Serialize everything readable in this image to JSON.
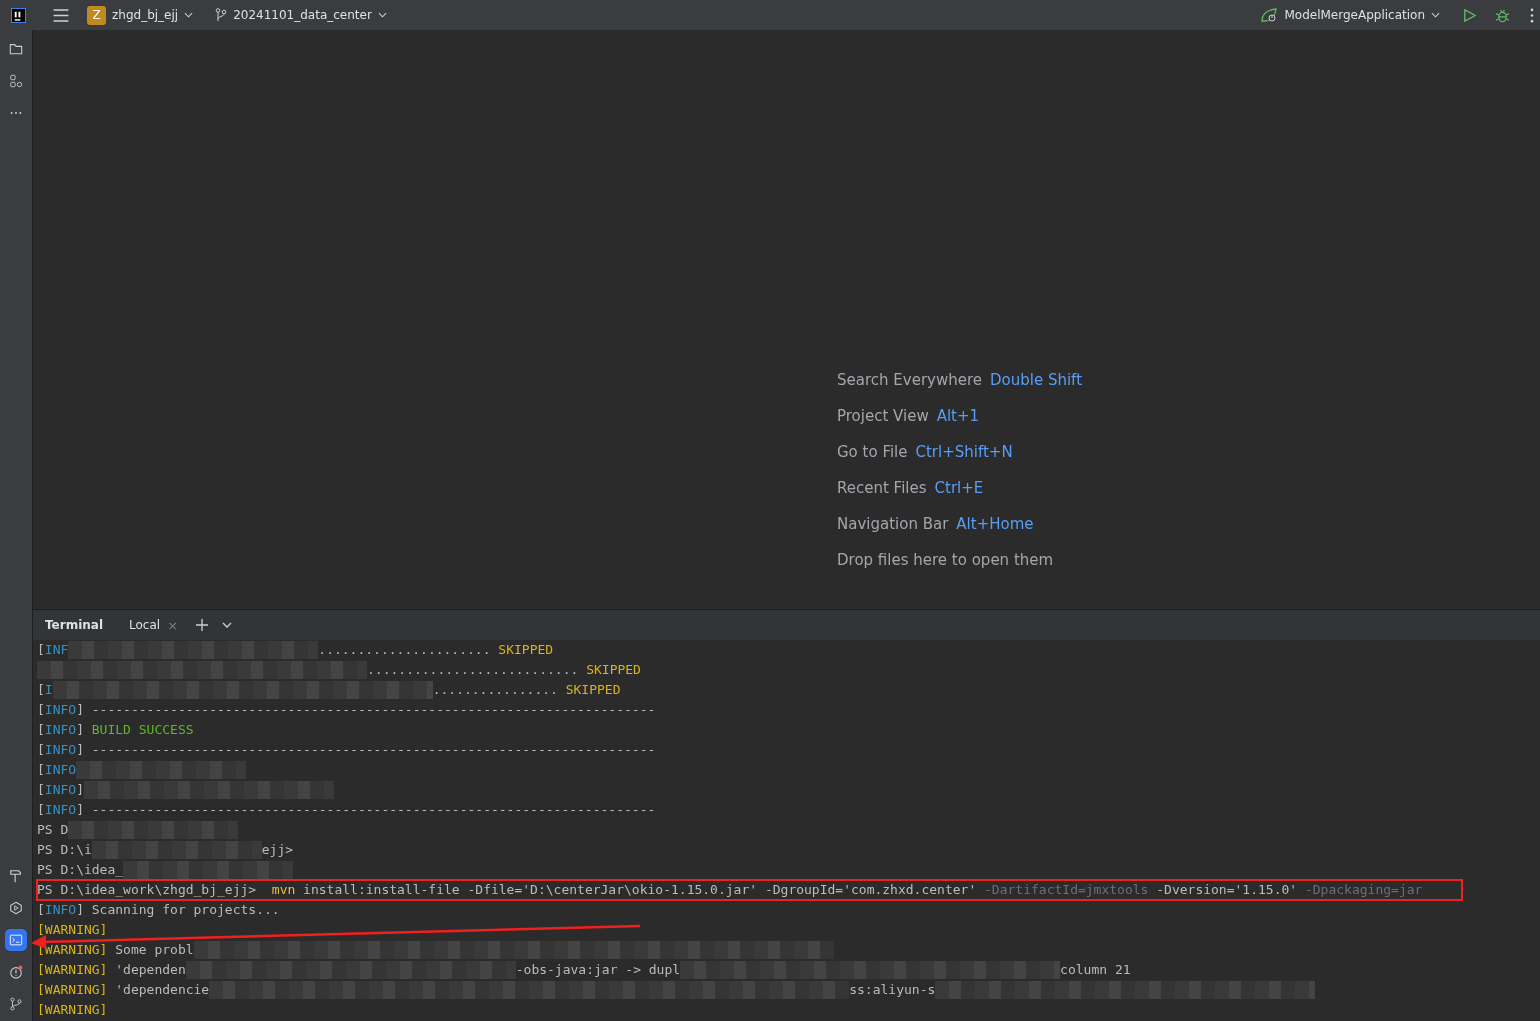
{
  "toolbar": {
    "project_badge": "Z",
    "project": "zhgd_bj_ejj",
    "branch": "20241101_data_center",
    "run_config": "ModelMergeApplication"
  },
  "sidebar": {
    "top_tools": [
      {
        "kind": "folder",
        "selected": false
      },
      {
        "kind": "structure",
        "selected": false
      },
      {
        "kind": "more",
        "selected": false
      }
    ],
    "bottom_tools": [
      {
        "kind": "build",
        "selected": false
      },
      {
        "kind": "services",
        "selected": false
      },
      {
        "kind": "terminal",
        "selected": true
      },
      {
        "kind": "problems",
        "selected": false
      },
      {
        "kind": "git",
        "selected": false
      }
    ]
  },
  "editor_hints": [
    {
      "label": "Search Everywhere",
      "shortcut": "Double Shift"
    },
    {
      "label": "Project View",
      "shortcut": "Alt+1"
    },
    {
      "label": "Go to File",
      "shortcut": "Ctrl+Shift+N"
    },
    {
      "label": "Recent Files",
      "shortcut": "Ctrl+E"
    },
    {
      "label": "Navigation Bar",
      "shortcut": "Alt+Home"
    },
    {
      "label": "Drop files here to open them"
    }
  ],
  "terminal": {
    "title": "Terminal",
    "tabs": [
      {
        "label": "Local",
        "close": "×",
        "selected": true
      }
    ],
    "lines": [
      {
        "boxed": false,
        "segments": [
          {
            "kind": "plain",
            "text": "["
          },
          {
            "kind": "info",
            "text": "INF"
          },
          {
            "kind": "mask_l"
          },
          {
            "kind": "plain",
            "text": "...................... "
          },
          {
            "kind": "skipped",
            "text": "SKIPPED"
          }
        ]
      },
      {
        "boxed": false,
        "segments": [
          {
            "kind": "mask_xl"
          },
          {
            "kind": "plain",
            "text": "........................... "
          },
          {
            "kind": "skipped",
            "text": "SKIPPED"
          }
        ]
      },
      {
        "boxed": false,
        "segments": [
          {
            "kind": "plain",
            "text": "["
          },
          {
            "kind": "info",
            "text": "I"
          },
          {
            "kind": "mask_xxl"
          },
          {
            "kind": "plain",
            "text": "................ "
          },
          {
            "kind": "skipped",
            "text": "SKIPPED"
          }
        ]
      },
      {
        "boxed": false,
        "segments": [
          {
            "kind": "plain",
            "text": "["
          },
          {
            "kind": "info",
            "text": "INFO"
          },
          {
            "kind": "plain",
            "text": "] ------------------------------------------------------------------------"
          }
        ]
      },
      {
        "boxed": false,
        "segments": [
          {
            "kind": "plain",
            "text": "["
          },
          {
            "kind": "info",
            "text": "INFO"
          },
          {
            "kind": "plain",
            "text": "] "
          },
          {
            "kind": "success",
            "text": "BUILD SUCCESS"
          }
        ]
      },
      {
        "boxed": false,
        "segments": [
          {
            "kind": "plain",
            "text": "["
          },
          {
            "kind": "info",
            "text": "INFO"
          },
          {
            "kind": "plain",
            "text": "] ------------------------------------------------------------------------"
          }
        ]
      },
      {
        "boxed": false,
        "segments": [
          {
            "kind": "plain",
            "text": "["
          },
          {
            "kind": "info",
            "text": "INFO"
          },
          {
            "kind": "mask_m"
          }
        ]
      },
      {
        "boxed": false,
        "segments": [
          {
            "kind": "plain",
            "text": "["
          },
          {
            "kind": "info",
            "text": "INFO"
          },
          {
            "kind": "plain",
            "text": "]"
          },
          {
            "kind": "mask_l"
          }
        ]
      },
      {
        "boxed": false,
        "segments": [
          {
            "kind": "plain",
            "text": "["
          },
          {
            "kind": "info",
            "text": "INFO"
          },
          {
            "kind": "plain",
            "text": "] ------------------------------------------------------------------------"
          }
        ]
      },
      {
        "boxed": false,
        "segments": [
          {
            "kind": "plain",
            "text": "PS D"
          },
          {
            "kind": "mask_m"
          }
        ]
      },
      {
        "boxed": false,
        "segments": [
          {
            "kind": "plain",
            "text": "PS D:\\i"
          },
          {
            "kind": "mask_m"
          },
          {
            "kind": "plain",
            "text": "ejj>"
          }
        ]
      },
      {
        "boxed": false,
        "segments": [
          {
            "kind": "plain",
            "text": "PS D:\\idea_"
          },
          {
            "kind": "mask_m"
          }
        ]
      },
      {
        "boxed": true,
        "segments": [
          {
            "kind": "plain",
            "text": "PS D:\\idea_work\\zhgd_bj_ejj>  "
          },
          {
            "kind": "command",
            "text": "mvn"
          },
          {
            "kind": "plain",
            "text": " install:install-file -Dfile='D:\\centerJar\\okio-1.15.0.jar' -DgroupId='com.zhxd.center' "
          },
          {
            "kind": "dim",
            "text": "-DartifactId=jmxtools"
          },
          {
            "kind": "plain",
            "text": " -Dversion='1.15.0' "
          },
          {
            "kind": "dim",
            "text": "-Dpackaging=jar"
          }
        ]
      },
      {
        "boxed": false,
        "segments": [
          {
            "kind": "plain",
            "text": "["
          },
          {
            "kind": "info",
            "text": "INFO"
          },
          {
            "kind": "plain",
            "text": "] Scanning for projects..."
          }
        ]
      },
      {
        "boxed": false,
        "segments": [
          {
            "kind": "warning",
            "text": "[WARNING]"
          }
        ]
      },
      {
        "boxed": false,
        "segments": [
          {
            "kind": "warning",
            "text": "[WARNING]"
          },
          {
            "kind": "plain",
            "text": " Some probl"
          },
          {
            "kind": "mask_huge"
          }
        ]
      },
      {
        "boxed": false,
        "segments": [
          {
            "kind": "warning",
            "text": "[WARNING]"
          },
          {
            "kind": "plain",
            "text": " 'dependen"
          },
          {
            "kind": "mask_xl"
          },
          {
            "kind": "plain",
            "text": "-obs-java:jar -> dupl"
          },
          {
            "kind": "mask_xxl"
          },
          {
            "kind": "plain",
            "text": "column 21"
          }
        ]
      },
      {
        "boxed": false,
        "segments": [
          {
            "kind": "warning",
            "text": "[WARNING]"
          },
          {
            "kind": "plain",
            "text": " 'dependencie"
          },
          {
            "kind": "mask_huge"
          },
          {
            "kind": "plain",
            "text": "ss:aliyun-s"
          },
          {
            "kind": "mask_xxl"
          }
        ]
      },
      {
        "boxed": false,
        "segments": [
          {
            "kind": "warning",
            "text": "[WARNING]"
          }
        ]
      }
    ]
  }
}
